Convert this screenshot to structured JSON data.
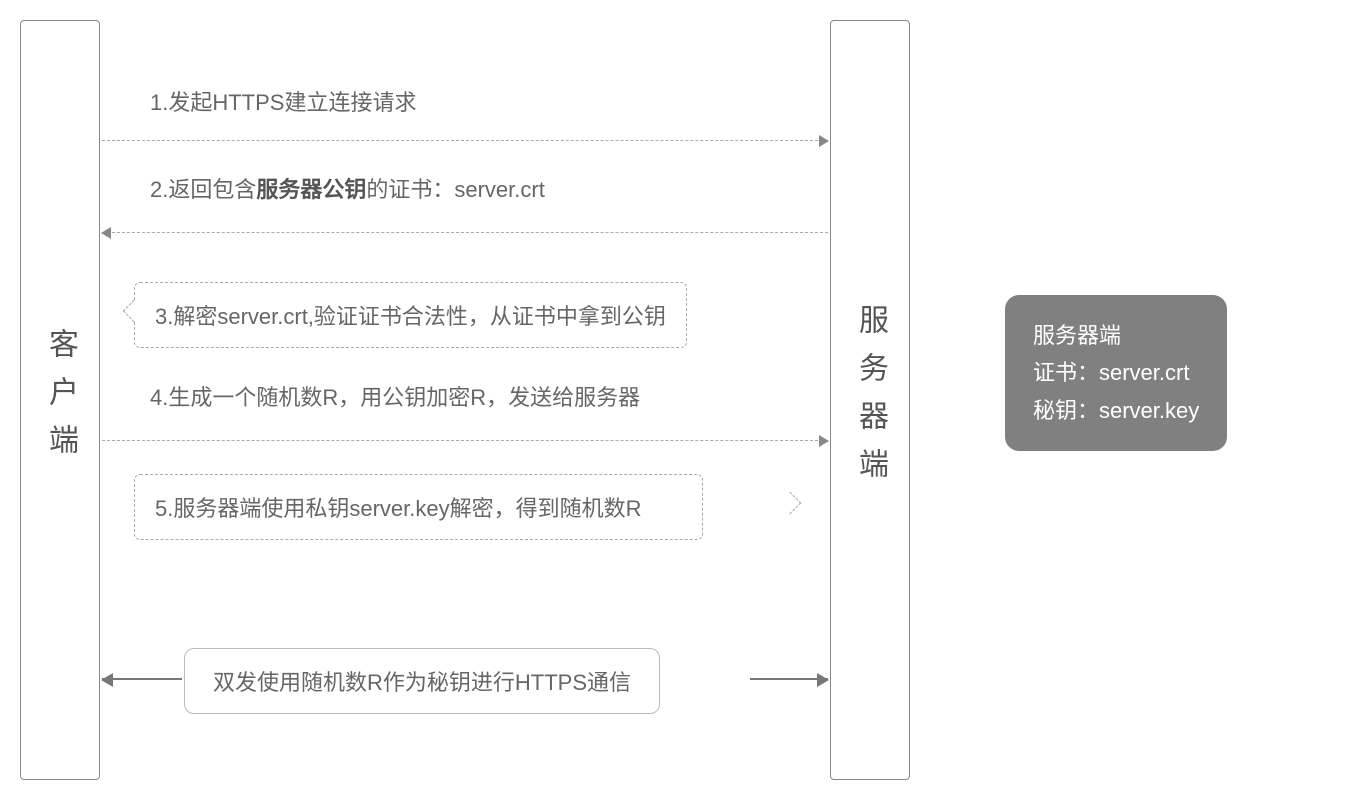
{
  "client": {
    "label": "客户端"
  },
  "server": {
    "label": "服务器端"
  },
  "steps": {
    "s1": "1.发起HTTPS建立连接请求",
    "s2_prefix": "2.返回包含",
    "s2_bold": "服务器公钥",
    "s2_suffix": "的证书：server.crt",
    "s3": "3.解密server.crt,验证证书合法性，从证书中拿到公钥",
    "s4": "4.生成一个随机数R，用公钥加密R，发送给服务器",
    "s5": "5.服务器端使用私钥server.key解密，得到随机数R",
    "final": "双发使用随机数R作为秘钥进行HTTPS通信"
  },
  "info": {
    "title": "服务器端",
    "cert": "证书：server.crt",
    "key": "秘钥：server.key"
  }
}
